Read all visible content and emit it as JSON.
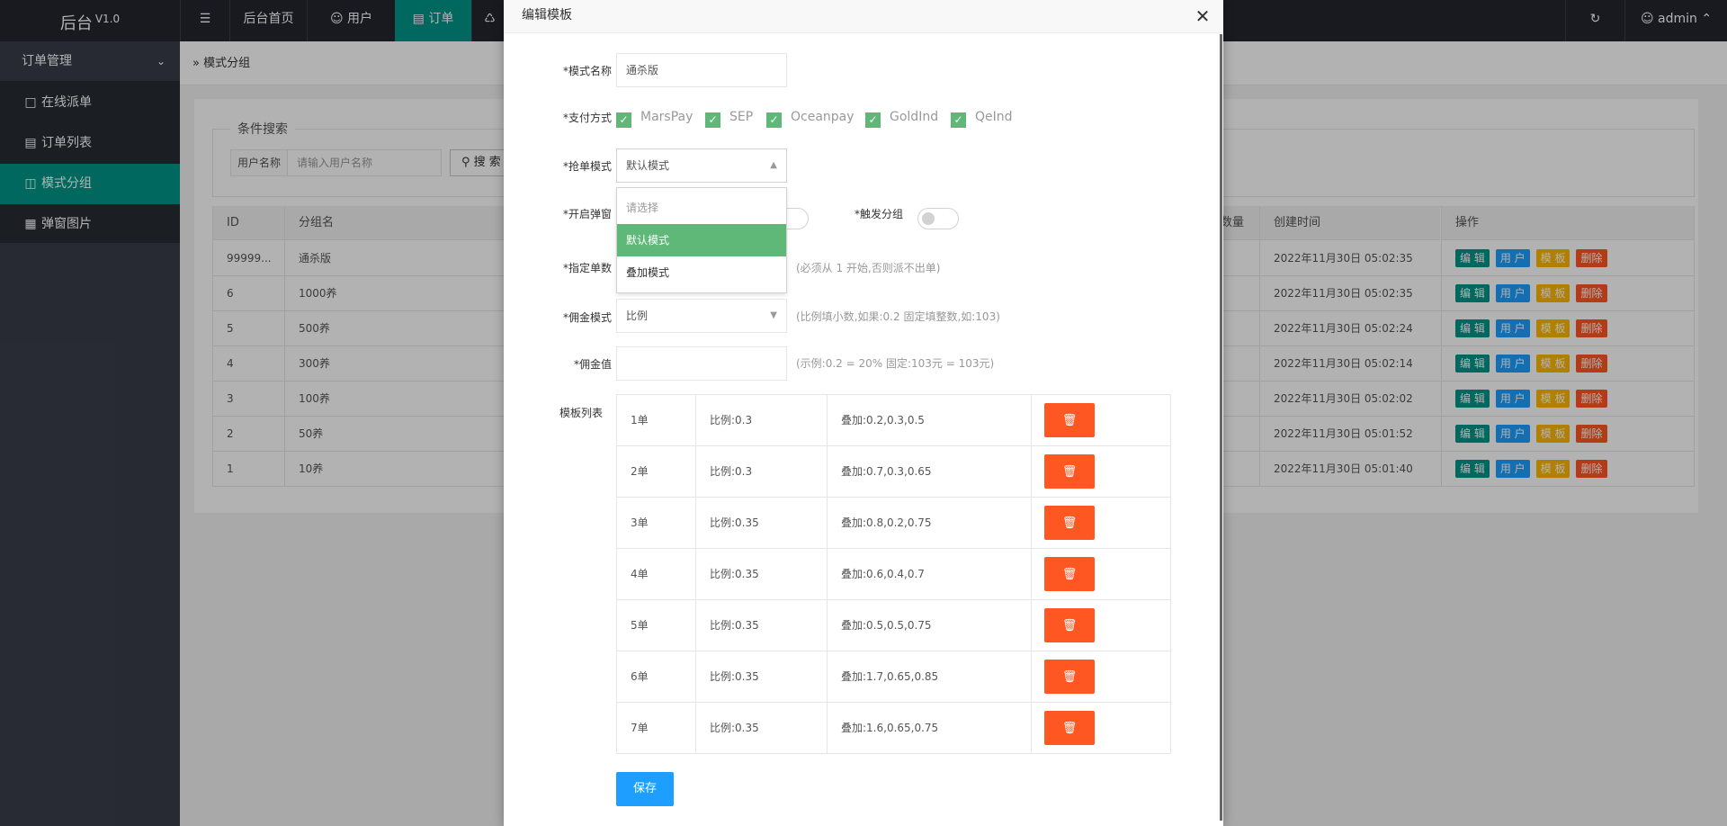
{
  "app": {
    "logo": "后台",
    "version": "V1.0"
  },
  "topnav": {
    "menu_icon": "menu-toggle-icon",
    "items": [
      {
        "label": "后台首页"
      },
      {
        "label": "用户",
        "icon": "user-icon"
      },
      {
        "label": "订单",
        "icon": "doc-icon",
        "active": true
      },
      {
        "label": "",
        "icon": "cart-icon"
      }
    ],
    "refresh_icon": "refresh-icon",
    "admin": "admin"
  },
  "sidebar": {
    "group": "订单管理",
    "items": [
      {
        "label": "在线派单",
        "icon": "file-icon"
      },
      {
        "label": "订单列表",
        "icon": "list-icon"
      },
      {
        "label": "模式分组",
        "icon": "group-icon",
        "active": true
      },
      {
        "label": "弹窗图片",
        "icon": "image-icon"
      }
    ]
  },
  "breadcrumb": {
    "sep": "»",
    "current": "模式分组"
  },
  "search": {
    "legend": "条件搜索",
    "label": "用户名称",
    "placeholder": "请输入用户名称",
    "button": "搜 索"
  },
  "table": {
    "headers": {
      "id": "ID",
      "name": "分组名",
      "count": "数量",
      "created": "创建时间",
      "ops": "操作"
    },
    "op_labels": {
      "edit": "编 辑",
      "user": "用 户",
      "tpl": "模 板",
      "del": "删除"
    },
    "rows": [
      {
        "id": "99999...",
        "name": "通杀版",
        "created": "2022年11月30日 05:02:35"
      },
      {
        "id": "6",
        "name": "1000养",
        "created": "2022年11月30日 05:02:35"
      },
      {
        "id": "5",
        "name": "500养",
        "created": "2022年11月30日 05:02:24"
      },
      {
        "id": "4",
        "name": "300养",
        "created": "2022年11月30日 05:02:14"
      },
      {
        "id": "3",
        "name": "100养",
        "created": "2022年11月30日 05:02:02"
      },
      {
        "id": "2",
        "name": "50养",
        "created": "2022年11月30日 05:01:52"
      },
      {
        "id": "1",
        "name": "10养",
        "created": "2022年11月30日 05:01:40"
      }
    ]
  },
  "modal": {
    "title": "编辑模板",
    "close_icon": "close-icon",
    "fields": {
      "mode_name": {
        "label": "*模式名称",
        "value": "通杀版"
      },
      "payment": {
        "label": "*支付方式",
        "options": [
          "MarsPay",
          "SEP",
          "Oceanpay",
          "GoldInd",
          "QeInd"
        ]
      },
      "grab_mode": {
        "label": "*抢单模式",
        "value": "默认模式",
        "options": [
          "请选择",
          "默认模式",
          "叠加模式"
        ]
      },
      "popup": {
        "label": "*开启弹窗"
      },
      "trigger_group": {
        "label": "*触发分组"
      },
      "order_count": {
        "label": "*指定单数",
        "hint": "(必须从 1 开始,否则派不出单)"
      },
      "commission_mode": {
        "label": "*佣金模式",
        "value": "比例",
        "hint": "(比例填小数,如果:0.2 固定填整数,如:103)"
      },
      "commission_value": {
        "label": "*佣金值",
        "value": "",
        "hint": "(示例:0.2 = 20% 固定:103元 = 103元)"
      }
    },
    "template_label": "模板列表",
    "templates": [
      {
        "order": "1单",
        "ratio": "比例:0.3",
        "stack": "叠加:0.2,0.3,0.5"
      },
      {
        "order": "2单",
        "ratio": "比例:0.3",
        "stack": "叠加:0.7,0.3,0.65"
      },
      {
        "order": "3单",
        "ratio": "比例:0.35",
        "stack": "叠加:0.8,0.2,0.75"
      },
      {
        "order": "4单",
        "ratio": "比例:0.35",
        "stack": "叠加:0.6,0.4,0.7"
      },
      {
        "order": "5单",
        "ratio": "比例:0.35",
        "stack": "叠加:0.5,0.5,0.75"
      },
      {
        "order": "6单",
        "ratio": "比例:0.35",
        "stack": "叠加:1.7,0.65,0.85"
      },
      {
        "order": "7单",
        "ratio": "比例:0.35",
        "stack": "叠加:1.6,0.65,0.75"
      }
    ],
    "save": "保存"
  },
  "colors": {
    "primary": "#009688",
    "checkbox": "#5fb878",
    "danger": "#ff5722",
    "save": "#1e9fff"
  }
}
